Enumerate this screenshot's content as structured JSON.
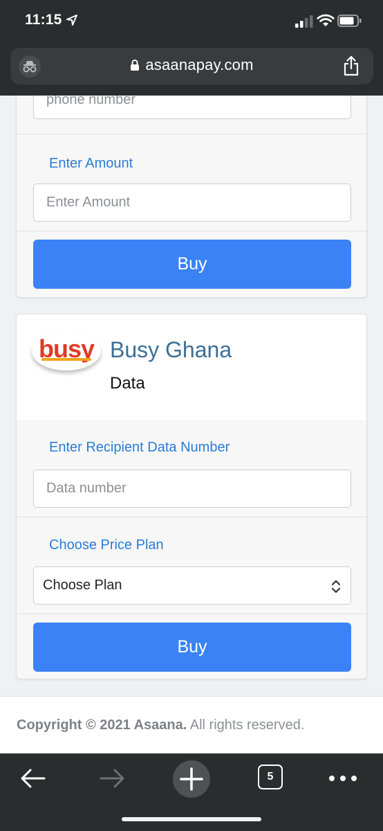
{
  "status_bar": {
    "time": "11:15"
  },
  "browser": {
    "url": "asaanapay.com"
  },
  "top_card": {
    "phone_placeholder": "phone number",
    "amount_label": "Enter Amount",
    "amount_placeholder": "Enter Amount",
    "buy_label": "Buy"
  },
  "data_card": {
    "logo_text": "busy",
    "brand_name": "Busy Ghana",
    "service_name": "Data",
    "recipient_label": "Enter Recipient Data Number",
    "recipient_placeholder": "Data number",
    "plan_label": "Choose Price Plan",
    "plan_value": "Choose Plan",
    "buy_label": "Buy"
  },
  "footer": {
    "copyright_bold": "Copyright © 2021 Asaana.",
    "copyright_rest": "All rights reserved."
  },
  "toolbar": {
    "tab_count": "5"
  },
  "colors": {
    "accent": "#3b82f6",
    "label_blue": "#2a7bd6",
    "brand_title": "#3b6f95",
    "logo_red": "#e03a26",
    "logo_orange": "#f3a21c"
  }
}
